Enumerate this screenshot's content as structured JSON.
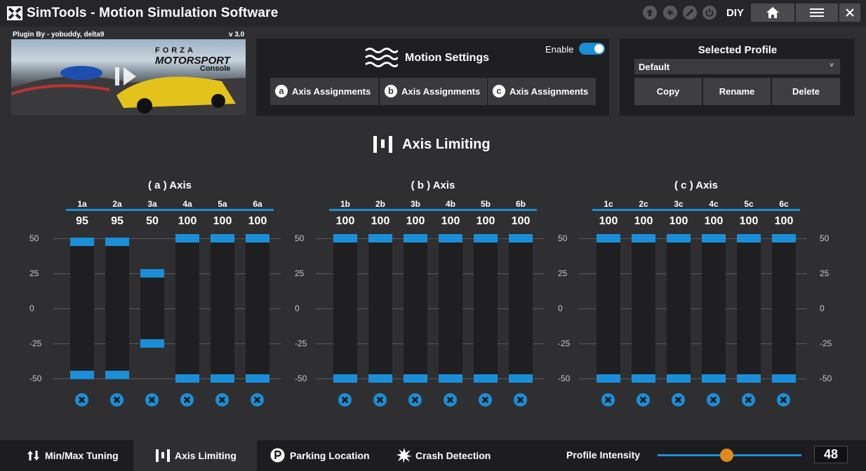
{
  "app": {
    "title": "SimTools - Motion Simulation Software",
    "mode_label": "DIY",
    "accent_color": "#1a8fd8"
  },
  "titlebar_icons": [
    "arrow-up-circle-icon",
    "crash-burst-circle-icon",
    "wrench-circle-icon",
    "power-circle-icon"
  ],
  "titlebar_buttons": [
    "home-icon",
    "hamburger-menu-icon",
    "close-icon"
  ],
  "plugin": {
    "author": "Plugin By - yobuddy, delta9",
    "version": "v 3.0",
    "game_logo_line1": "FORZA",
    "game_logo_line2": "MOTORSPORT",
    "game_logo_line3": "Console"
  },
  "motion_settings": {
    "title": "Motion Settings",
    "enable_label": "Enable",
    "enabled": true,
    "axis_assignments": [
      {
        "badge": "a",
        "label": "Axis Assignments"
      },
      {
        "badge": "b",
        "label": "Axis Assignments"
      },
      {
        "badge": "c",
        "label": "Axis Assignments"
      }
    ]
  },
  "profile": {
    "title": "Selected Profile",
    "selected": "Default",
    "dropdown_caret": "˅",
    "buttons": [
      "Copy",
      "Rename",
      "Delete"
    ]
  },
  "section": {
    "title": "Axis Limiting"
  },
  "scale_ticks": [
    "50",
    "25",
    "0",
    "-25",
    "-50"
  ],
  "axis_groups": [
    {
      "title": "( a ) Axis",
      "columns": [
        {
          "label": "1a",
          "value": "95"
        },
        {
          "label": "2a",
          "value": "95"
        },
        {
          "label": "3a",
          "value": "50"
        },
        {
          "label": "4a",
          "value": "100"
        },
        {
          "label": "5a",
          "value": "100"
        },
        {
          "label": "6a",
          "value": "100"
        }
      ]
    },
    {
      "title": "( b ) Axis",
      "columns": [
        {
          "label": "1b",
          "value": "100"
        },
        {
          "label": "2b",
          "value": "100"
        },
        {
          "label": "3b",
          "value": "100"
        },
        {
          "label": "4b",
          "value": "100"
        },
        {
          "label": "5b",
          "value": "100"
        },
        {
          "label": "6b",
          "value": "100"
        }
      ]
    },
    {
      "title": "( c ) Axis",
      "columns": [
        {
          "label": "1c",
          "value": "100"
        },
        {
          "label": "2c",
          "value": "100"
        },
        {
          "label": "3c",
          "value": "100"
        },
        {
          "label": "4c",
          "value": "100"
        },
        {
          "label": "5c",
          "value": "100"
        },
        {
          "label": "6c",
          "value": "100"
        }
      ]
    }
  ],
  "bottom_tabs": [
    {
      "label": "Min/Max Tuning",
      "icon": "up-down-arrows-icon",
      "active": false
    },
    {
      "label": "Axis Limiting",
      "icon": "axis-limiting-icon",
      "active": true
    },
    {
      "label": "Parking Location",
      "icon": "parking-icon",
      "active": false
    },
    {
      "label": "Crash Detection",
      "icon": "crash-burst-icon",
      "active": false
    }
  ],
  "intensity": {
    "label": "Profile Intensity",
    "value": "48",
    "slider_fraction": 0.48,
    "thumb_color": "#e08a1e"
  }
}
